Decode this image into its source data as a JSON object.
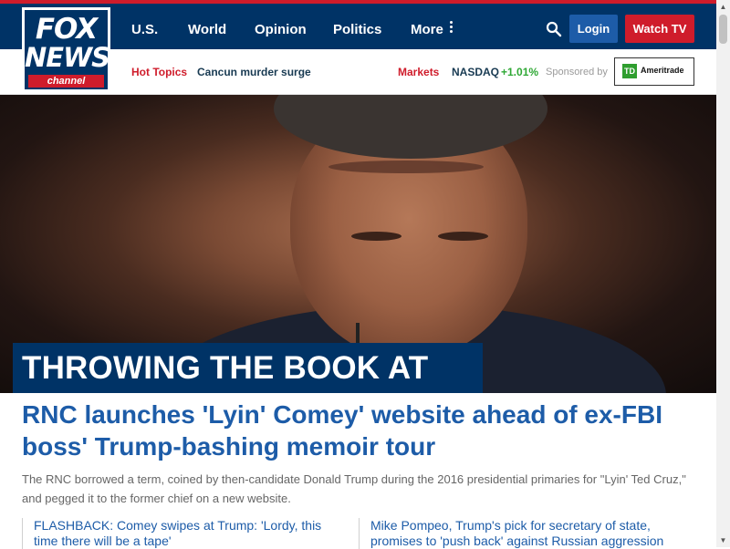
{
  "logo": {
    "fox": "FOX",
    "news": "NEWS",
    "channel": "channel"
  },
  "nav": {
    "links": [
      "U.S.",
      "World",
      "Opinion",
      "Politics",
      "More"
    ],
    "login_label": "Login",
    "watch_label": "Watch TV"
  },
  "subnav": {
    "hot_topics": "Hot Topics",
    "topic_1": "Cancun murder surge",
    "markets": "Markets",
    "nasdaq_label": "NASDAQ",
    "nasdaq_change": "+1.01%",
    "sponsored_by": "Sponsored by",
    "sponsor_name": "Ameritrade",
    "sponsor_mark": "TD"
  },
  "hero": {
    "kicker": "THROWING THE BOOK AT HIM"
  },
  "article": {
    "headline": "RNC launches 'Lyin' Comey' website ahead of ex-FBI boss' Trump-bashing memoir tour",
    "summary": "The RNC borrowed a term, coined by then-candidate Donald Trump during the 2016 presidential primaries for \"Lyin' Ted Cruz,\" and pegged it to the former chief on a new website.",
    "related": [
      "FLASHBACK: Comey swipes at Trump: 'Lordy, this time there will be a tape'",
      "Mike Pompeo, Trump's pick for secretary of state, promises to 'push back' against Russian aggression"
    ]
  },
  "colors": {
    "navy": "#003366",
    "red": "#cf1c2b",
    "link_blue": "#1d5ca8",
    "green": "#2fa835"
  }
}
